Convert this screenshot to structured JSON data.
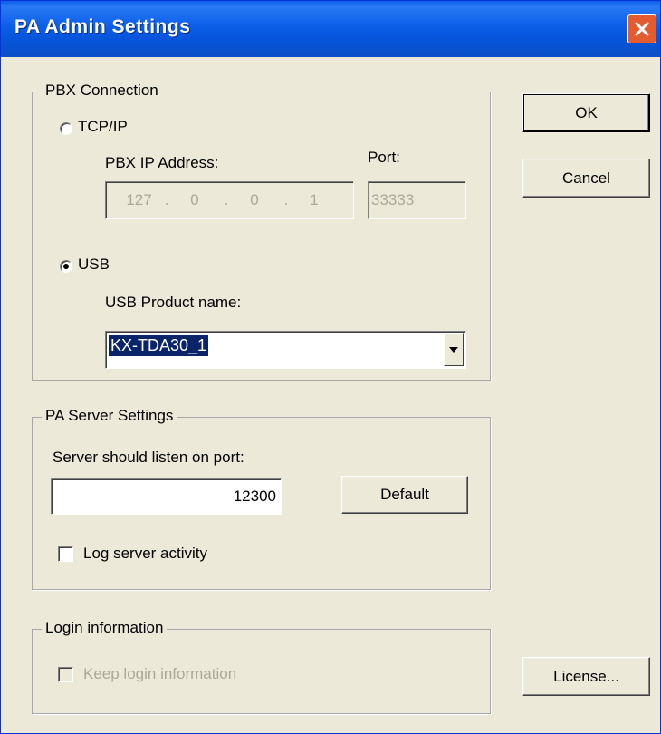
{
  "window": {
    "title": "PA Admin Settings"
  },
  "pbx": {
    "legend": "PBX Connection",
    "tcp_label": "TCP/IP",
    "ip_label": "PBX IP Address:",
    "port_label": "Port:",
    "ip_octets": [
      "127",
      "0",
      "0",
      "1"
    ],
    "port_value": "33333",
    "usb_label": "USB",
    "usb_product_label": "USB Product name:",
    "usb_product_value": "KX-TDA30_1",
    "selected_mode": "USB"
  },
  "server": {
    "legend": "PA Server Settings",
    "port_label": "Server should listen on port:",
    "port_value": "12300",
    "default_button": "Default",
    "log_label": "Log server activity",
    "log_checked": false
  },
  "login": {
    "legend": "Login information",
    "keep_label": "Keep login information",
    "keep_checked": false,
    "enabled": false
  },
  "buttons": {
    "ok": "OK",
    "cancel": "Cancel",
    "license": "License..."
  },
  "colors": {
    "titlebar": "#0a5fe8",
    "dialog_bg": "#ece9d8",
    "selection": "#0a246a",
    "close_button": "#e35b2f"
  }
}
